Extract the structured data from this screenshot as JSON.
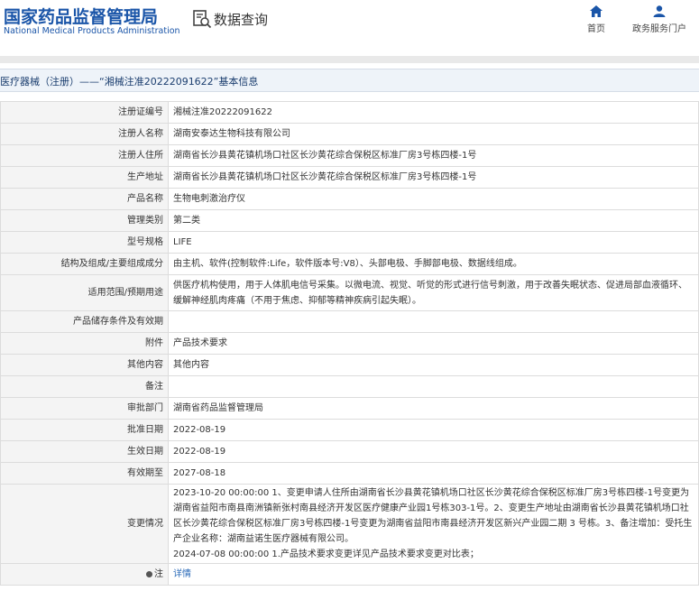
{
  "header": {
    "logo_cn": "国家药品监督管理局",
    "logo_en": "National Medical Products Administration",
    "query_label": "数据查询",
    "nav": [
      {
        "label": "首页",
        "icon": "home-icon"
      },
      {
        "label": "政务服务门户",
        "icon": "user-icon"
      }
    ]
  },
  "breadcrumb": "医疗器械（注册）——“湘械注准20222091622”基本信息",
  "rows": [
    {
      "label": "注册证编号",
      "value": "湘械注准20222091622"
    },
    {
      "label": "注册人名称",
      "value": "湖南安泰达生物科技有限公司"
    },
    {
      "label": "注册人住所",
      "value": "湖南省长沙县黄花镇机场口社区长沙黄花综合保税区标准厂房3号栋四楼-1号"
    },
    {
      "label": "生产地址",
      "value": "湖南省长沙县黄花镇机场口社区长沙黄花综合保税区标准厂房3号栋四楼-1号"
    },
    {
      "label": "产品名称",
      "value": "生物电刺激治疗仪"
    },
    {
      "label": "管理类别",
      "value": "第二类"
    },
    {
      "label": "型号规格",
      "value": "LIFE"
    },
    {
      "label": "结构及组成/主要组成成分",
      "value": "由主机、软件(控制软件:Life，软件版本号:V8）、头部电极、手脚部电极、数据线组成。"
    },
    {
      "label": "适用范围/预期用途",
      "value": "供医疗机构使用，用于人体肌电信号采集。以微电流、视觉、听觉的形式进行信号刺激，用于改善失眠状态、促进局部血液循环、缓解神经肌肉疼痛（不用于焦虑、抑郁等精神疾病引起失眠）。"
    },
    {
      "label": "产品储存条件及有效期",
      "value": ""
    },
    {
      "label": "附件",
      "value": "产品技术要求"
    },
    {
      "label": "其他内容",
      "value": "其他内容"
    },
    {
      "label": "备注",
      "value": ""
    },
    {
      "label": "审批部门",
      "value": "湖南省药品监督管理局"
    },
    {
      "label": "批准日期",
      "value": "2022-08-19"
    },
    {
      "label": "生效日期",
      "value": "2022-08-19"
    },
    {
      "label": "有效期至",
      "value": "2027-08-18"
    },
    {
      "label": "变更情况",
      "value": "2023-10-20 00:00:00 1、变更申请人住所由湖南省长沙县黄花镇机场口社区长沙黄花综合保税区标准厂房3号栋四楼-1号变更为湖南省益阳市南县南洲镇新张村南县经济开发区医疗健康产业园1号栋303-1号。2、变更生产地址由湖南省长沙县黄花镇机场口社区长沙黄花综合保税区标准厂房3号栋四楼-1号变更为湖南省益阳市南县经济开发区新兴产业园二期 3 号栋。3、备注增加：受托生产企业名称：湖南益诺生医疗器械有限公司。",
      "value2": "2024-07-08 00:00:00 1.产品技术要求变更详见产品技术要求变更对比表；"
    },
    {
      "label": "注",
      "value": "详情"
    }
  ]
}
